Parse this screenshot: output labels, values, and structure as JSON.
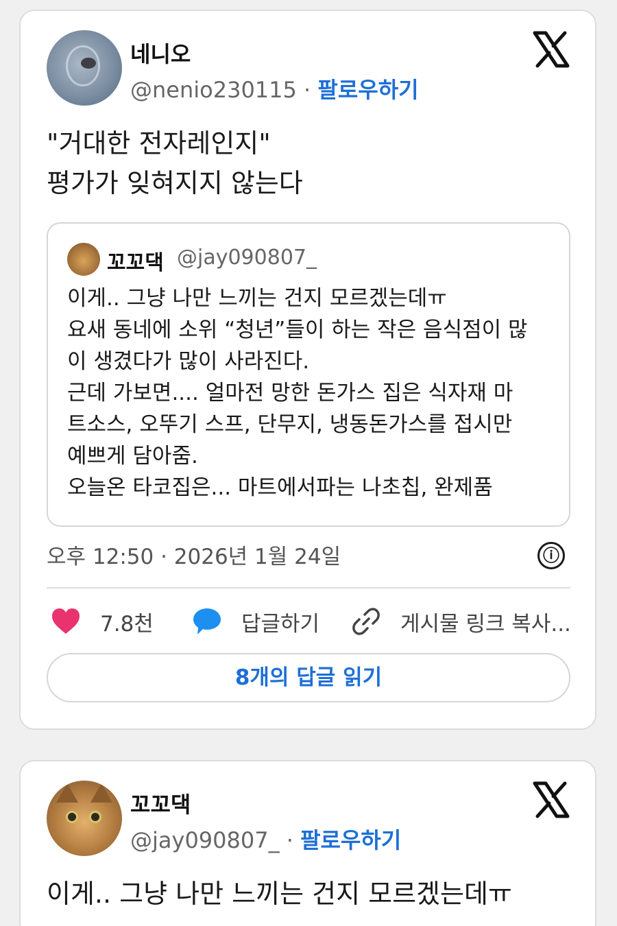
{
  "post1": {
    "author_name": "네니오",
    "author_handle": "@nenio230115",
    "separator": "·",
    "follow_label": "팔로우하기",
    "logo_icon": "x-logo-icon",
    "text_lines": [
      "\"거대한 전자레인지\"",
      "평가가 잊혀지지 않는다"
    ],
    "quote": {
      "author_name": "꼬꼬댁",
      "author_handle": "@jay090807_",
      "text_lines": [
        "이게.. 그냥 나만 느끼는 건지 모르겠는데ㅠ",
        "요새 동네에 소위 “청년”들이 하는 작은 음식점이 많",
        "이 생겼다가 많이 사라진다.",
        "근데 가보면.... 얼마전 망한 돈가스 집은 식자재 마",
        "트소스, 오뚜기 스프, 단무지, 냉동돈가스를 접시만",
        "예쁘게 담아줌.",
        "오늘온 타코집은... 마트에서파는 나초칩, 완제품"
      ]
    },
    "timestamp": "오후 12:50 · 2026년 1월 24일",
    "info_icon": "ⓘ",
    "like_count": "7.8천",
    "reply_label": "답글하기",
    "copy_link_label": "게시물 링크 복사...",
    "read_replies_label": "8개의 답글 읽기"
  },
  "post2": {
    "author_name": "꼬꼬댁",
    "author_handle": "@jay090807_",
    "separator": "·",
    "follow_label": "팔로우하기",
    "text_lines": [
      "이게.. 그냥 나만 느끼는 건지 모르겠는데ㅠ"
    ]
  },
  "colors": {
    "accent": "#1d6fd6",
    "like": "#e8336e",
    "reply_icon": "#1d8ff0",
    "background": "#f0f0f0"
  }
}
